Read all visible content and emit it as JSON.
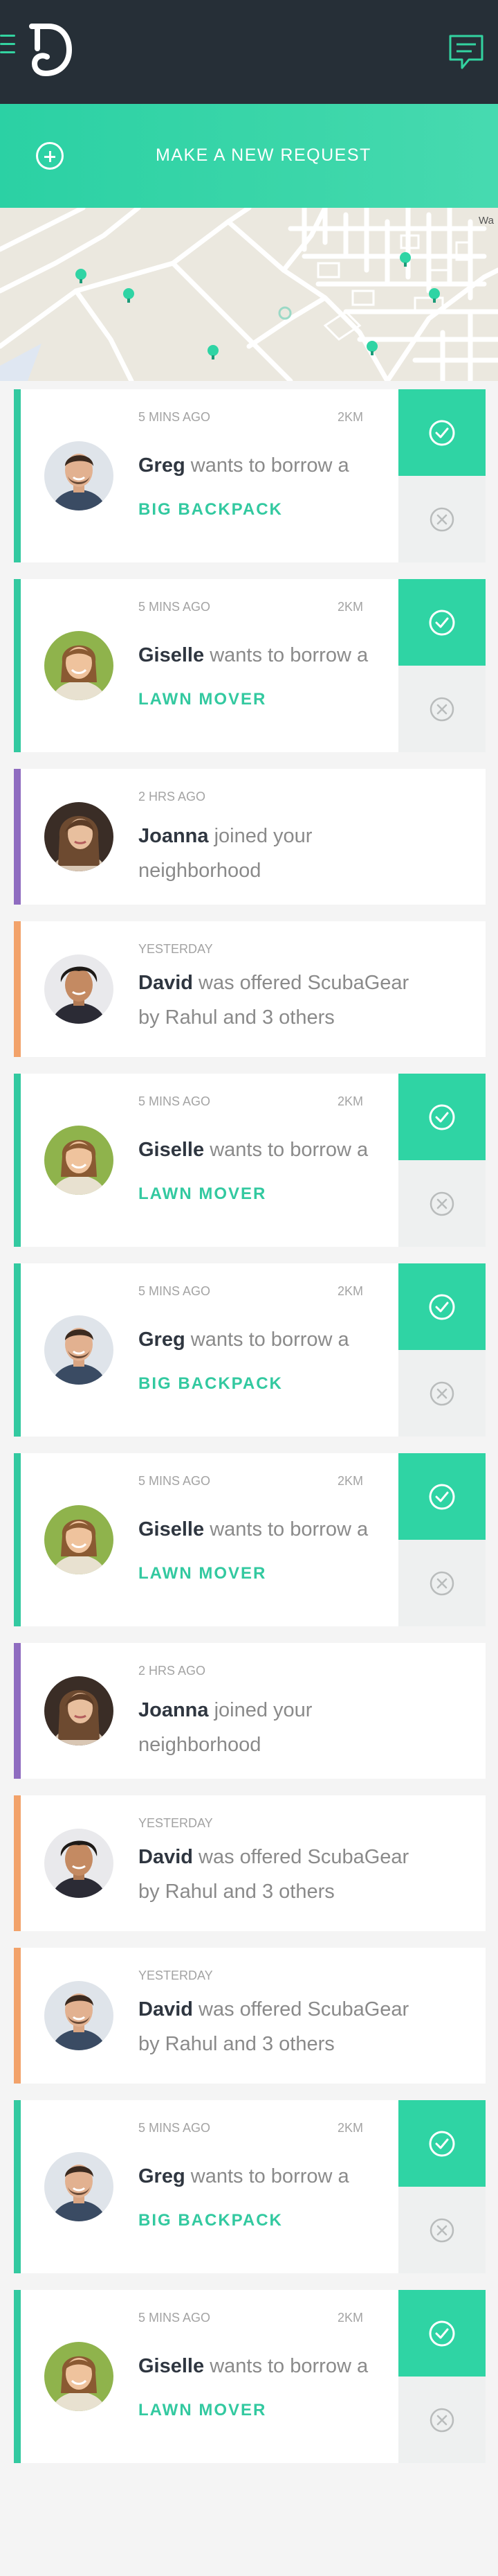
{
  "header": {
    "menu_icon": "hamburger-menu-icon",
    "logo_icon": "app-logo",
    "chat_icon": "chat-bubble-icon",
    "accent_color": "#2fd4a4",
    "background_color": "#262f37"
  },
  "request_bar": {
    "label": "MAKE A NEW REQUEST",
    "icon": "plus-circle-icon"
  },
  "map": {
    "corner_label": "Wa"
  },
  "feed": [
    {
      "type": "request",
      "time": "5 MINS AGO",
      "distance": "2KM",
      "name": "Greg",
      "action": "wants to borrow a",
      "item": "BIG BACKPACK",
      "avatar": "man-1"
    },
    {
      "type": "request",
      "time": "5 MINS AGO",
      "distance": "2KM",
      "name": "Giselle",
      "action": "wants to borrow a",
      "item": "LAWN MOVER",
      "avatar": "woman-1"
    },
    {
      "type": "info",
      "color": "purple",
      "time": "2 HRS AGO",
      "name": "Joanna",
      "action": "joined your neighborhood",
      "avatar": "woman-2"
    },
    {
      "type": "info",
      "color": "orange",
      "time": "YESTERDAY",
      "name": "David",
      "action": "was offered ScubaGear by Rahul and 3 others",
      "avatar": "man-2"
    },
    {
      "type": "request",
      "time": "5 MINS AGO",
      "distance": "2KM",
      "name": "Giselle",
      "action": "wants to borrow a",
      "item": "LAWN MOVER",
      "avatar": "woman-1"
    },
    {
      "type": "request",
      "time": "5 MINS AGO",
      "distance": "2KM",
      "name": "Greg",
      "action": "wants to borrow a",
      "item": "BIG BACKPACK",
      "avatar": "man-1"
    },
    {
      "type": "request",
      "time": "5 MINS AGO",
      "distance": "2KM",
      "name": "Giselle",
      "action": "wants to borrow a",
      "item": "LAWN MOVER",
      "avatar": "woman-1"
    },
    {
      "type": "info",
      "color": "purple",
      "time": "2 HRS AGO",
      "name": "Joanna",
      "action": "joined your neighborhood",
      "avatar": "woman-2"
    },
    {
      "type": "info",
      "color": "orange",
      "time": "YESTERDAY",
      "name": "David",
      "action": "was offered ScubaGear by Rahul and 3 others",
      "avatar": "man-2"
    },
    {
      "type": "info",
      "color": "orange",
      "time": "YESTERDAY",
      "name": "David",
      "action": "was offered ScubaGear by Rahul and 3 others",
      "avatar": "man-1"
    },
    {
      "type": "request",
      "time": "5 MINS AGO",
      "distance": "2KM",
      "name": "Greg",
      "action": "wants to borrow a",
      "item": "BIG BACKPACK",
      "avatar": "man-1"
    },
    {
      "type": "request",
      "time": "5 MINS AGO",
      "distance": "2KM",
      "name": "Giselle",
      "action": "wants to borrow a",
      "item": "LAWN MOVER",
      "avatar": "woman-1"
    }
  ]
}
